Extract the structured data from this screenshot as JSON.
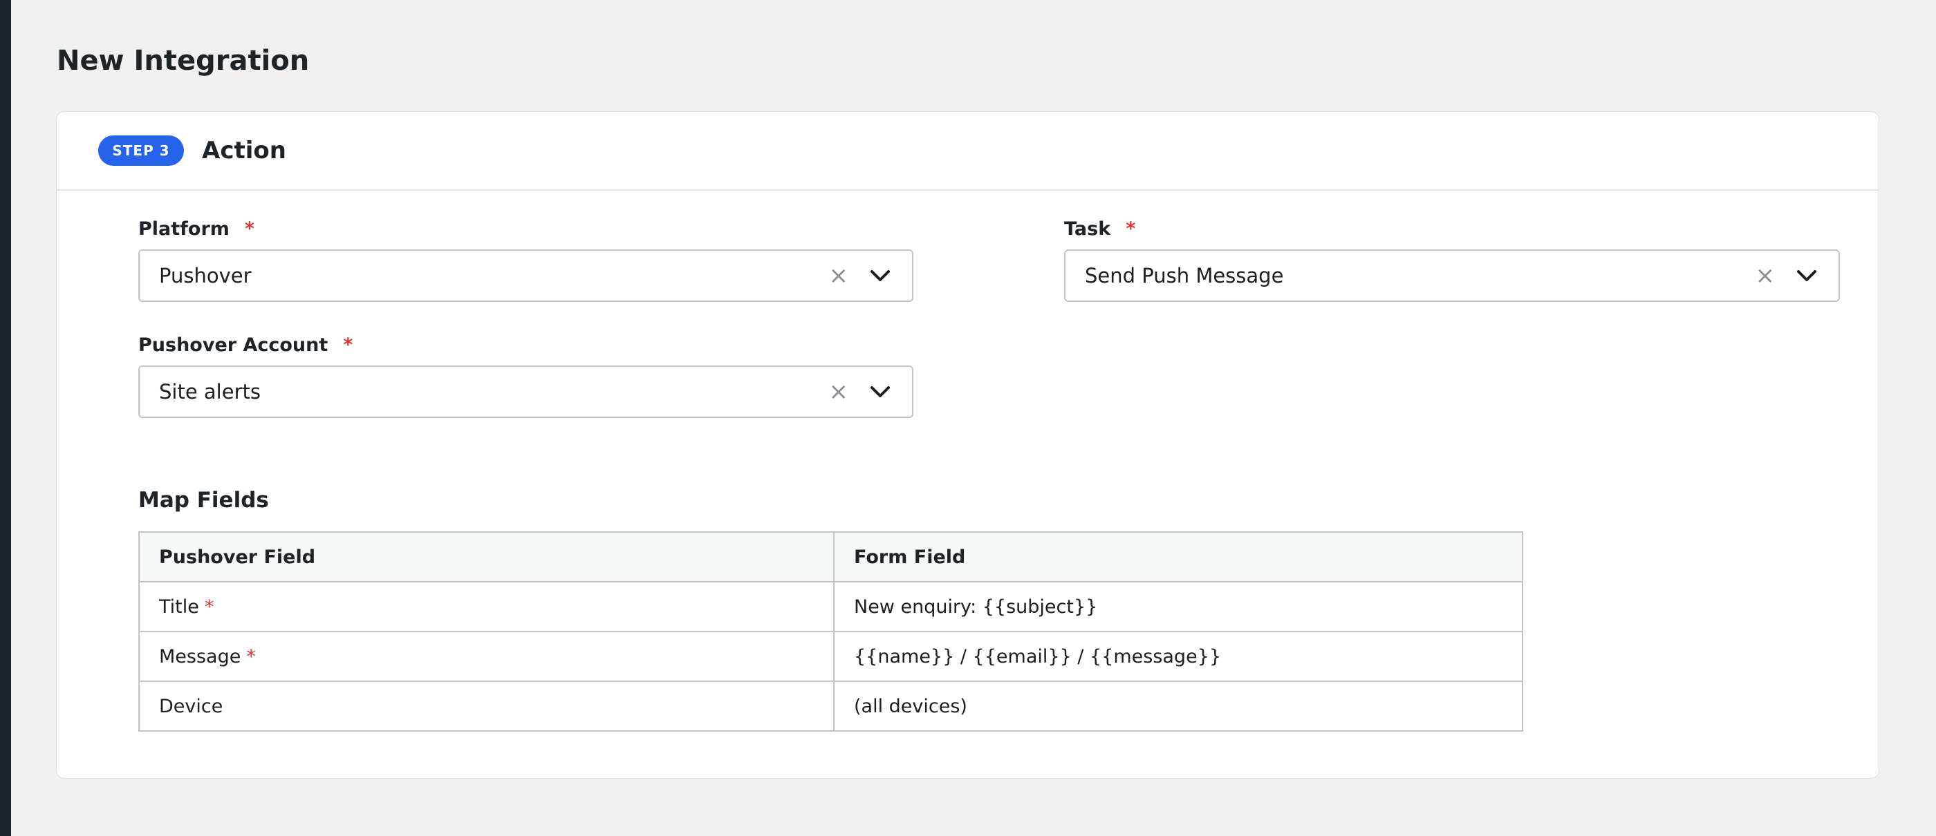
{
  "page": {
    "title": "New Integration"
  },
  "step": {
    "badge": "STEP 3",
    "title": "Action"
  },
  "fields": {
    "platform": {
      "label": "Platform",
      "required_mark": "*",
      "value": "Pushover"
    },
    "task": {
      "label": "Task",
      "required_mark": "*",
      "value": "Send Push Message"
    },
    "account": {
      "label": "Pushover Account",
      "required_mark": "*",
      "value": "Site alerts"
    }
  },
  "icons": {
    "clear": "close-icon",
    "dropdown": "chevron-down-icon"
  },
  "map_fields": {
    "title": "Map Fields",
    "headers": [
      "Pushover Field",
      "Form Field"
    ],
    "rows": [
      {
        "field": "Title",
        "required": "*",
        "value": "New enquiry: {{subject}}"
      },
      {
        "field": "Message",
        "required": "*",
        "value": "{{name}} / {{email}} / {{message}}"
      },
      {
        "field": "Device",
        "required": "",
        "value": "(all devices)"
      }
    ]
  },
  "colors": {
    "accent": "#2563eb",
    "required": "#d63638",
    "sidebar": "#1d2327"
  }
}
